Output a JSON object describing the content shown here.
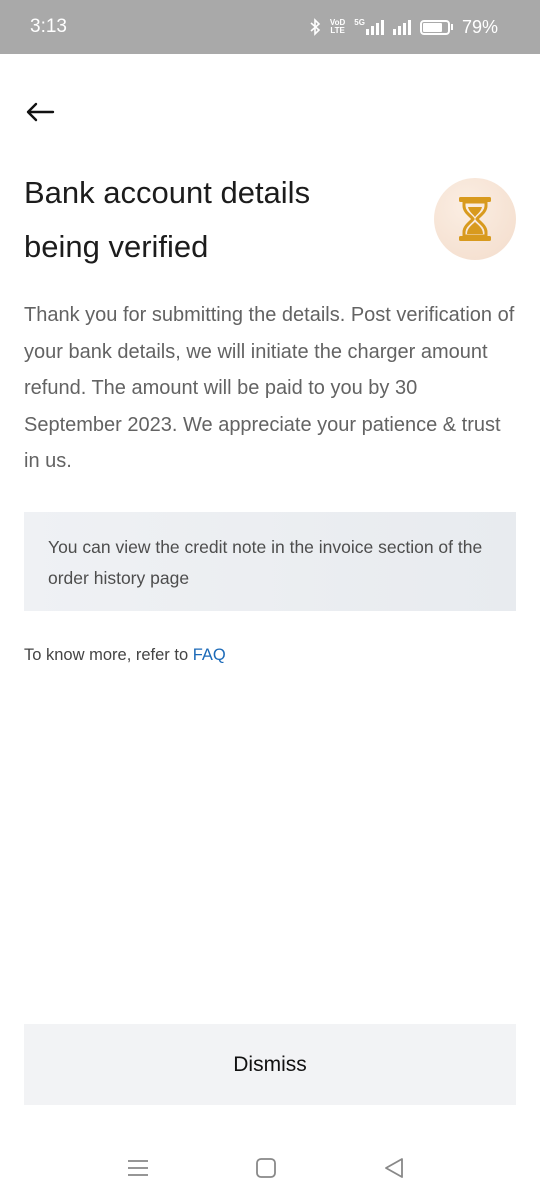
{
  "status_bar": {
    "time": "3:13",
    "volte_line1": "VoD",
    "volte_line2": "LTE",
    "network": "5G",
    "battery": "79%",
    "battery_level": 0.79
  },
  "header": {
    "back_icon": "arrow-left-icon",
    "title": "Bank account details being verified",
    "status_icon": "hourglass-icon"
  },
  "content": {
    "message": "Thank you for submitting the details. Post verification of your bank details, we will initiate the charger amount refund. The amount will be paid to you by 30 September 2023. We appreciate your patience & trust in us.",
    "info_note": "You can view the credit note in the invoice section of the order history page",
    "faq_prefix": "To know more, refer to ",
    "faq_link": "FAQ"
  },
  "actions": {
    "dismiss_label": "Dismiss"
  },
  "nav_bar": {
    "items": [
      "menu-icon",
      "home-square-icon",
      "back-triangle-icon"
    ]
  },
  "colors": {
    "status_bar_bg": "#a9a9a9",
    "accent_gold": "#d89a1e",
    "link_blue": "#1c6ab8",
    "icon_bg": "#f3dccb"
  }
}
